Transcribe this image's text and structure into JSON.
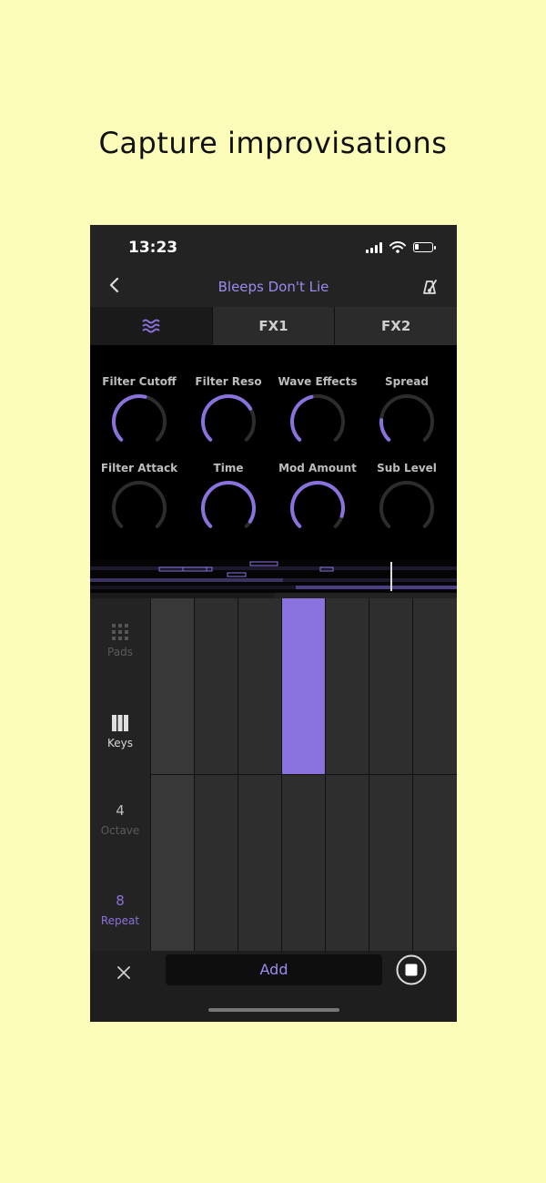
{
  "headline": "Capture improvisations",
  "status": {
    "time": "13:23"
  },
  "nav": {
    "title": "Bleeps Don't Lie",
    "back_icon": "chevron-left-icon",
    "right_icon": "metronome-icon"
  },
  "tabs": [
    {
      "label": "",
      "icon": "wave-icon"
    },
    {
      "label": "FX1"
    },
    {
      "label": "FX2"
    }
  ],
  "knobs": [
    {
      "label": "Filter Cutoff",
      "value": 0.55
    },
    {
      "label": "Filter Reso",
      "value": 0.72
    },
    {
      "label": "Wave Effects",
      "value": 0.45
    },
    {
      "label": "Spread",
      "value": 0.18
    },
    {
      "label": "Filter Attack",
      "value": 0.0
    },
    {
      "label": "Time",
      "value": 0.95
    },
    {
      "label": "Mod Amount",
      "value": 0.9
    },
    {
      "label": "Sub Level",
      "value": 0.0
    }
  ],
  "side": {
    "pads_label": "Pads",
    "keys_label": "Keys",
    "octave_value": "4",
    "octave_label": "Octave",
    "repeat_value": "8",
    "repeat_label": "Repeat"
  },
  "bottom": {
    "add_label": "Add"
  },
  "colors": {
    "accent": "#8a72de",
    "background": "#fbfdb8",
    "pad": "#2e2e2e",
    "pad_active": "#8a72de"
  }
}
